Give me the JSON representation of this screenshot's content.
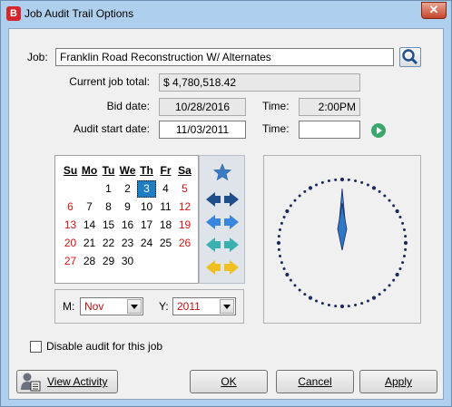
{
  "window": {
    "title": "Job Audit Trail Options",
    "close_label": "✕"
  },
  "job": {
    "label": "Job:",
    "value": "Franklin Road Reconstruction W/ Alternates"
  },
  "current_job_total": {
    "label": "Current job total:",
    "value": "$  4,780,518.42"
  },
  "bid": {
    "date_label": "Bid date:",
    "date_value": "10/28/2016",
    "time_label": "Time:",
    "time_value": "2:00PM"
  },
  "audit_start": {
    "date_label": "Audit start date:",
    "date_value": "11/03/2011",
    "time_label": "Time:",
    "time_value": ""
  },
  "calendar": {
    "weekdays": [
      "Su",
      "Mo",
      "Tu",
      "We",
      "Th",
      "Fr",
      "Sa"
    ],
    "weeks": [
      [
        "",
        "",
        "1",
        "2",
        "3",
        "4",
        "5"
      ],
      [
        "6",
        "7",
        "8",
        "9",
        "10",
        "11",
        "12"
      ],
      [
        "13",
        "14",
        "15",
        "16",
        "17",
        "18",
        "19"
      ],
      [
        "20",
        "21",
        "22",
        "23",
        "24",
        "25",
        "26"
      ],
      [
        "27",
        "28",
        "29",
        "30",
        "",
        "",
        ""
      ]
    ],
    "selected_day": "3",
    "month_label": "M:",
    "month_value": "Nov",
    "year_label": "Y:",
    "year_value": "2011"
  },
  "nav_icons": [
    "star-icon",
    "double-arrow-navy-icon",
    "double-arrow-blue-icon",
    "double-arrow-teal-icon",
    "double-arrow-yellow-icon"
  ],
  "clock": {
    "hour": 12,
    "minute": 0
  },
  "disable_audit": {
    "label": "Disable audit for this job",
    "checked": false
  },
  "buttons": {
    "view_activity": "View Activity",
    "ok": "OK",
    "cancel": "Cancel",
    "apply": "Apply"
  },
  "colors": {
    "accent": "#1f7ec2",
    "weekend_red": "#d21414",
    "title_bar": "#aed0ee"
  }
}
